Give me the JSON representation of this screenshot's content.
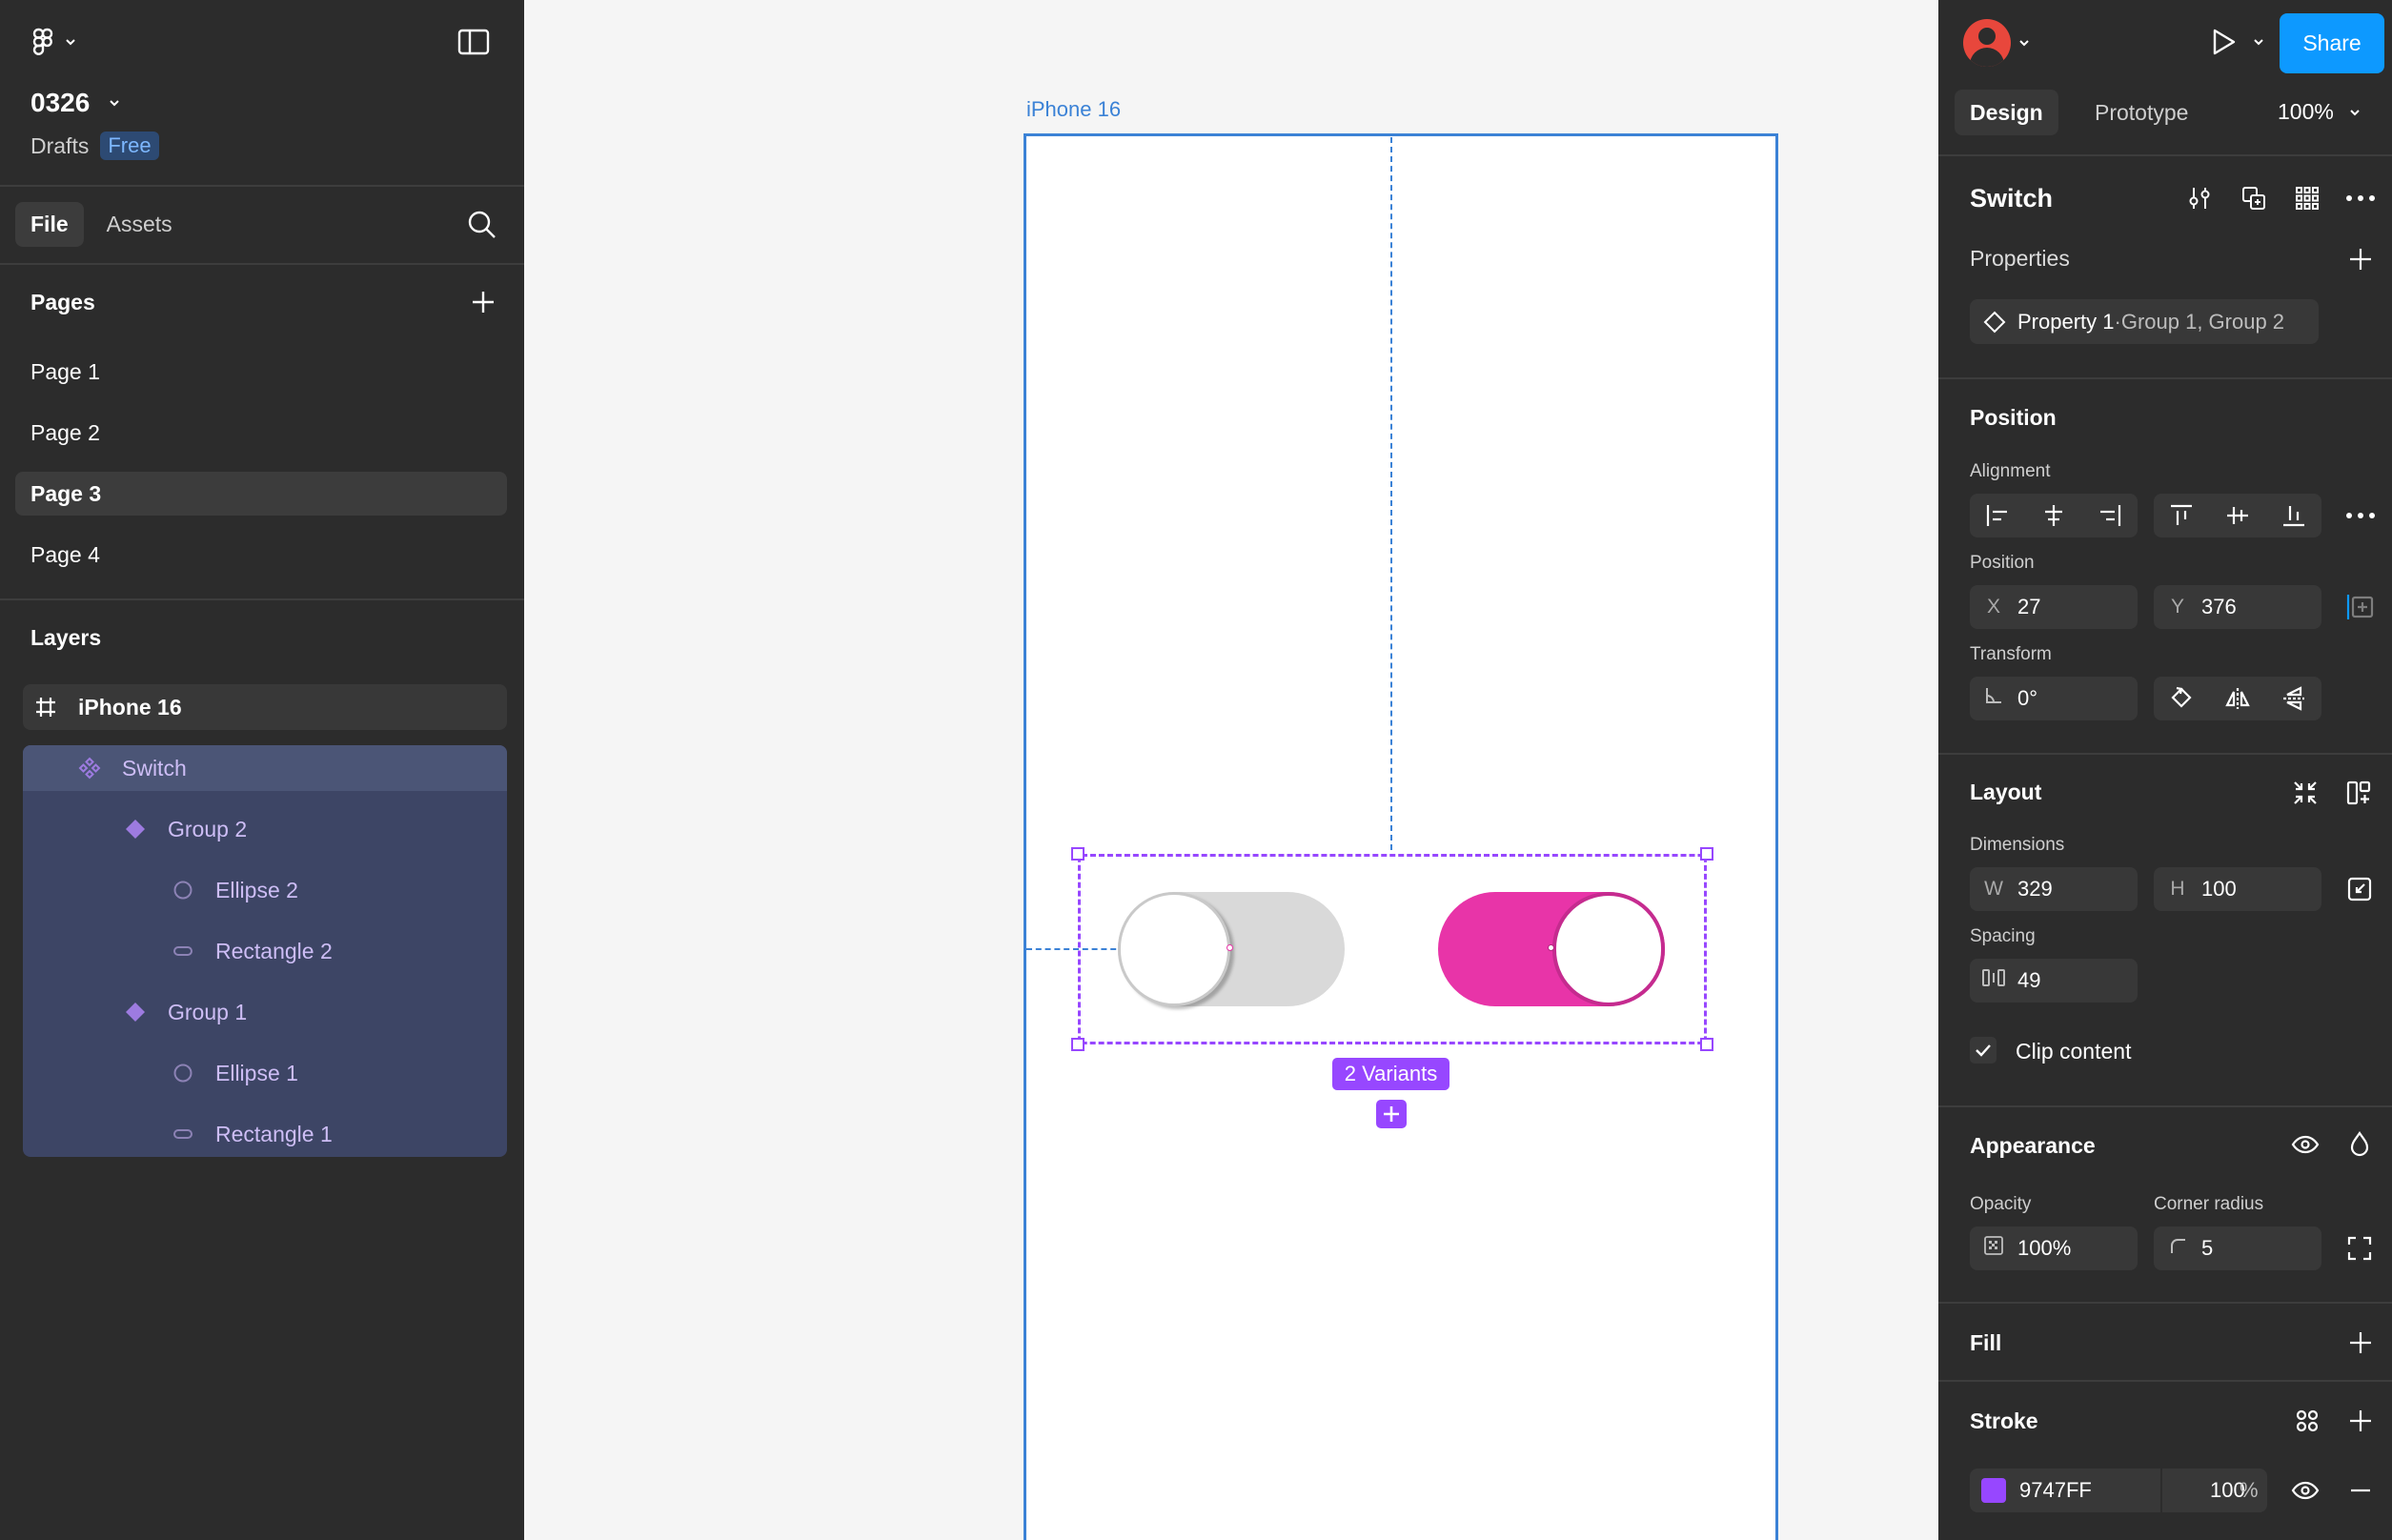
{
  "file": {
    "name": "0326",
    "location": "Drafts",
    "plan": "Free"
  },
  "left_tabs": {
    "file": "File",
    "assets": "Assets"
  },
  "pages": {
    "title": "Pages",
    "items": [
      "Page 1",
      "Page 2",
      "Page 3",
      "Page 4"
    ],
    "active": "Page 3"
  },
  "layers": {
    "title": "Layers",
    "frame": "iPhone 16",
    "component": "Switch",
    "group2": "Group 2",
    "ellipse2": "Ellipse 2",
    "rect2": "Rectangle 2",
    "group1": "Group 1",
    "ellipse1": "Ellipse 1",
    "rect1": "Rectangle 1"
  },
  "canvas": {
    "frame_label": "iPhone 16",
    "variants_badge": "2 Variants",
    "switch_off_color": "#d9d9d9",
    "switch_on_color": "#e834a8",
    "selection_color": "#9747FF"
  },
  "right": {
    "share": "Share",
    "tabs": {
      "design": "Design",
      "prototype": "Prototype"
    },
    "zoom": "100%",
    "component_name": "Switch",
    "properties": {
      "title": "Properties",
      "prop_name": "Property 1",
      "prop_values": "·Group 1, Group 2"
    },
    "position": {
      "title": "Position",
      "alignment_label": "Alignment",
      "position_label": "Position",
      "x_label": "X",
      "x": "27",
      "y_label": "Y",
      "y": "376",
      "transform_label": "Transform",
      "rotation": "0°"
    },
    "layout": {
      "title": "Layout",
      "dimensions_label": "Dimensions",
      "w_label": "W",
      "w": "329",
      "h_label": "H",
      "h": "100",
      "spacing_label": "Spacing",
      "spacing": "49",
      "clip_label": "Clip content"
    },
    "appearance": {
      "title": "Appearance",
      "opacity_label": "Opacity",
      "opacity": "100%",
      "radius_label": "Corner radius",
      "radius": "5"
    },
    "fill": {
      "title": "Fill"
    },
    "stroke": {
      "title": "Stroke",
      "color": "9747FF",
      "opacity": "100",
      "pct": "%"
    },
    "accent_color": "#0d99ff"
  }
}
